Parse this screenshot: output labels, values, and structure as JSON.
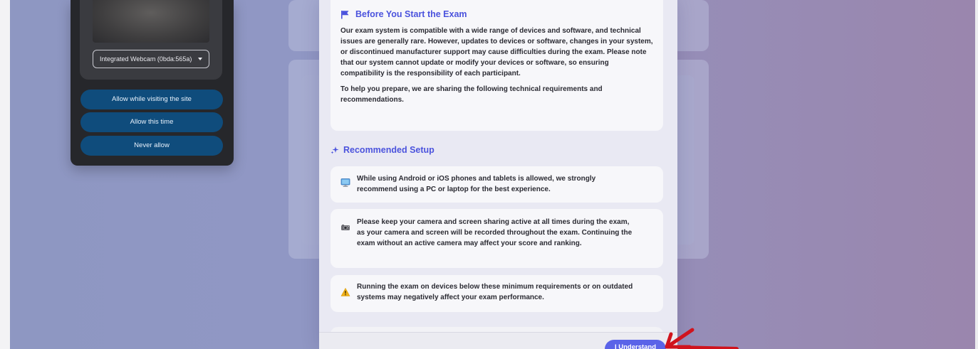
{
  "permission_popup": {
    "camera_select": "Integrated Webcam (0bda:565a)",
    "buttons": [
      "Allow while visiting the site",
      "Allow this time",
      "Never allow"
    ]
  },
  "modal": {
    "before_start": {
      "title": "Before You Start the Exam",
      "paragraph1": "Our exam system is compatible with a wide range of devices and software, and technical issues are generally rare. However, updates to devices or software, changes in your system, or discontinued manufacturer support may cause difficulties during the exam. Please note that our system cannot update or modify your devices or software, so ensuring compatibility is the responsibility of each participant.",
      "paragraph2": "To help you prepare, we are sharing the following technical requirements and recommendations."
    },
    "recommended": {
      "title": "Recommended Setup",
      "items": [
        {
          "icon": "computer-icon",
          "text": "While using Android or iOS phones and tablets is allowed, we strongly recommend using a PC or laptop for the best experience."
        },
        {
          "icon": "camera-icon",
          "text": "Please keep your camera and screen sharing active at all times during the exam, as your camera and screen will be recorded throughout the exam. Continuing the exam without an active camera may affect your score and ranking."
        },
        {
          "icon": "warning-icon",
          "text": "Running the exam on devices below these minimum requirements or on outdated systems may negatively affect your exam performance."
        }
      ]
    },
    "understand_button": "I Understand"
  },
  "colors": {
    "accent": "#4b53dd",
    "button": "#5a63e8",
    "permission_button": "#0f4c7c",
    "annotation_arrow": "#d0131d"
  }
}
